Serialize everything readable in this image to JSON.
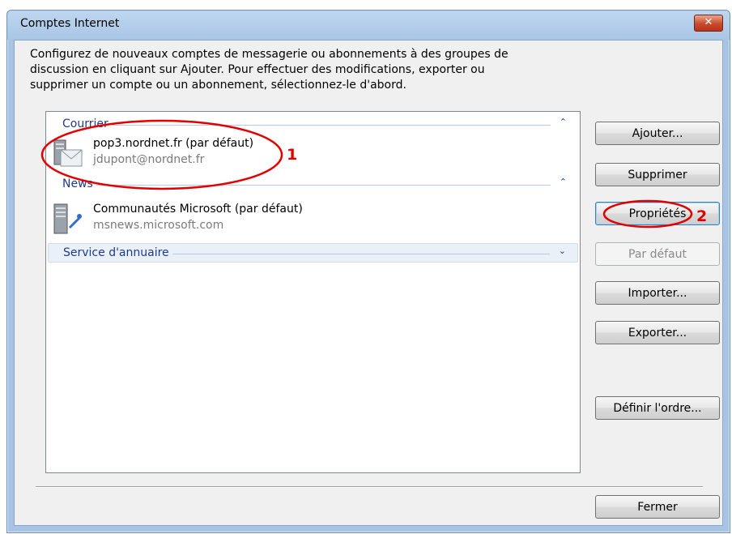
{
  "window": {
    "title": "Comptes Internet",
    "close_glyph": "✕"
  },
  "description": [
    "Configurez de nouveaux comptes de messagerie ou abonnements à des groupes de",
    "discussion en cliquant sur Ajouter. Pour effectuer des modifications, exporter ou",
    "supprimer un compte ou un abonnement, sélectionnez-le d'abord."
  ],
  "groups": [
    {
      "label": "Courrier",
      "state": "expanded",
      "chevron": "⌃",
      "items": [
        {
          "name": "pop3.nordnet.fr (par défaut)",
          "detail": "jdupont@nordnet.fr",
          "icon": "mail-account-icon"
        }
      ]
    },
    {
      "label": "News",
      "state": "expanded",
      "chevron": "⌃",
      "items": [
        {
          "name": "Communautés Microsoft (par défaut)",
          "detail": "msnews.microsoft.com",
          "icon": "news-server-icon"
        }
      ]
    },
    {
      "label": "Service d'annuaire",
      "state": "collapsed",
      "chevron": "⌄",
      "items": []
    }
  ],
  "buttons": {
    "add": "Ajouter...",
    "remove": "Supprimer",
    "properties": "Propriétés",
    "set_default": "Par défaut",
    "import": "Importer...",
    "export": "Exporter...",
    "set_order": "Définir l'ordre...",
    "close": "Fermer"
  },
  "annotations": {
    "one": "1",
    "two": "2",
    "color": "#e00000"
  },
  "colors": {
    "accent": "#1e3a8a",
    "title_bar": "#a9c6e6",
    "close_button": "#c94a2b"
  }
}
